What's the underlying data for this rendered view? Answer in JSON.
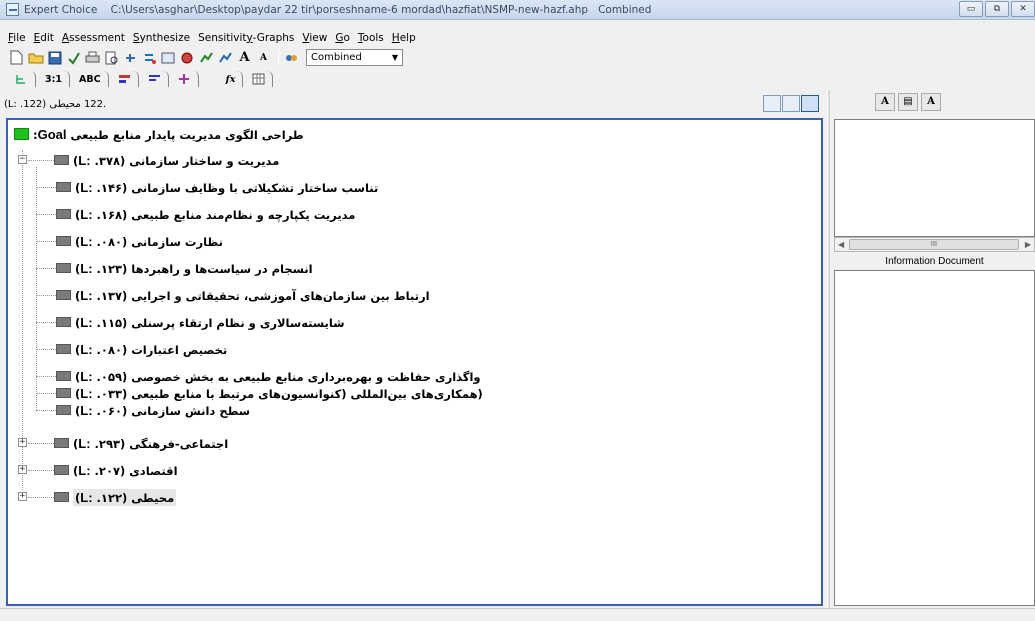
{
  "window": {
    "app_name": "Expert Choice",
    "path": "C:\\Users\\asghar\\Desktop\\paydar 22 tir\\porseshname-6 mordad\\hazfiat\\NSMP-new-hazf.ahp",
    "mode": "Combined"
  },
  "menu": [
    "File",
    "Edit",
    "Assessment",
    "Synthesize",
    "Sensitivity-Graphs",
    "View",
    "Go",
    "Tools",
    "Help"
  ],
  "menu_underline": [
    "F",
    "E",
    "A",
    "S",
    "y",
    "V",
    "G",
    "T",
    "H"
  ],
  "toolbar": {
    "combined_select": "Combined"
  },
  "toolbar2": {
    "ratio_tab": "3:1",
    "abc_tab": "ABC"
  },
  "status": {
    "current_node": ".122 محیطی (L: .122)"
  },
  "tree": {
    "goal": {
      "prefix": "Goal",
      "text": "طراحی الگوی مدیریت پایدار منابع طبیعی"
    },
    "nodes": [
      {
        "text": "مدیریت و ساختار سازمانی",
        "local": "۳۷۸",
        "expanded": true
      },
      {
        "text": "تناسب ساختار تشکیلاتی با وظایف سازمانی",
        "local": "۱۴۶"
      },
      {
        "text": "مدیریت یکپارچه و نظام‌مند منابع طبیعی",
        "local": "۱۶۸"
      },
      {
        "text": "نظارت سازمانی",
        "local": "۰۸۰"
      },
      {
        "text": "انسجام در سیاست‌ها و راهبردها",
        "local": "۱۲۳"
      },
      {
        "text": "ارتباط بین سازمان‌های آموزشی، تحقیقاتی و اجرایی",
        "local": "۱۳۷"
      },
      {
        "text": "شایسته‌سالاری و نظام ارتقاء پرسنلی",
        "local": "۱۱۵"
      },
      {
        "text": "تخصیص اعتبارات",
        "local": "۰۸۰"
      },
      {
        "text": "واگذاری حفاظت و بهره‌برداری منابع طبیعی به بخش خصوصی",
        "local": "۰۵۹"
      },
      {
        "text": "(همکاری‌های بین‌المللی (کنوانسیون‌های مرتبط با منابع طبیعی",
        "local": "۰۳۳"
      },
      {
        "text": "سطح دانش سازمانی",
        "local": "۰۶۰"
      },
      {
        "text": "اجتماعی-فرهنگی",
        "local": "۲۹۳",
        "expanded": false
      },
      {
        "text": "اقتصادی",
        "local": "۲۰۷",
        "expanded": false
      },
      {
        "text": "محیطی",
        "local": "۱۲۲",
        "expanded": false
      }
    ]
  },
  "right_panel": {
    "info_label": "Information Document",
    "scroll_thumb": "III"
  }
}
